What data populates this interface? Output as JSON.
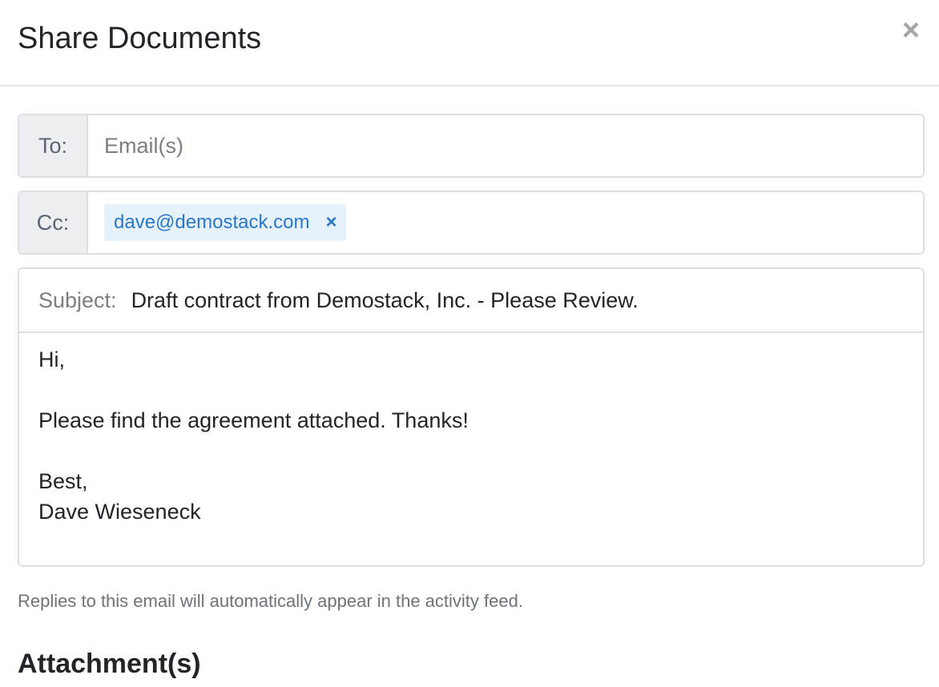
{
  "modal": {
    "title": "Share Documents",
    "close_glyph": "×",
    "close_icon": "close-icon"
  },
  "to": {
    "label": "To:",
    "placeholder": "Email(s)",
    "value": ""
  },
  "cc": {
    "label": "Cc:",
    "recipients": [
      {
        "email": "dave@demostack.com",
        "remove_glyph": "×"
      }
    ]
  },
  "message": {
    "subject_label": "Subject:",
    "subject": "Draft contract from Demostack, Inc. - Please Review.",
    "body": "Hi,\n\nPlease find the agreement attached. Thanks!\n\nBest,\nDave Wieseneck"
  },
  "help_text": "Replies to this email will automatically appear in the activity feed.",
  "attachments": {
    "heading": "Attachment(s)"
  },
  "colors": {
    "tag_background": "#e6f2fb",
    "tag_text": "#2a77c8",
    "label_background": "#eceef1"
  }
}
